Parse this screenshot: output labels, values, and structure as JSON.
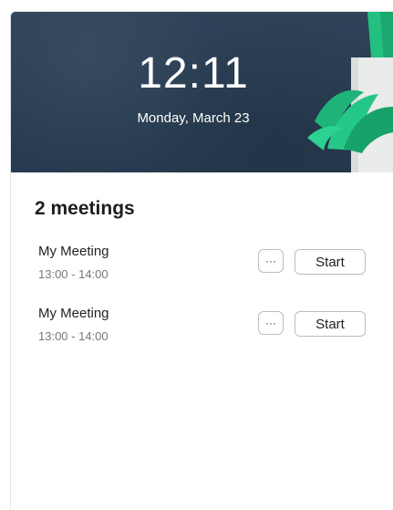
{
  "header": {
    "time": "12:11",
    "date": "Monday, March 23"
  },
  "meetings": {
    "count_label": "2 meetings",
    "items": [
      {
        "title": "My Meeting",
        "time": "13:00 - 14:00",
        "more_label": "···",
        "start_label": "Start"
      },
      {
        "title": "My Meeting",
        "time": "13:00 - 14:00",
        "more_label": "···",
        "start_label": "Start"
      }
    ]
  },
  "colors": {
    "header_bg": "#2b3f55",
    "plant_green": "#1fb37a",
    "pot": "#e9eceb"
  },
  "icons": {
    "plant": "plant-illustration"
  }
}
